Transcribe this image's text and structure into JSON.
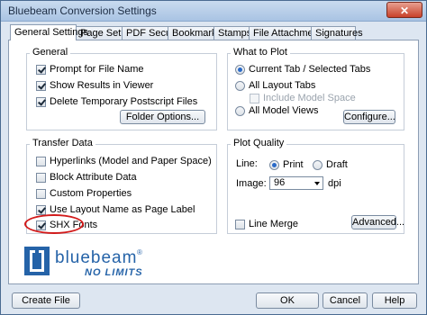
{
  "window": {
    "title": "Bluebeam Conversion Settings",
    "close_label": "✕"
  },
  "tabs": [
    {
      "label": "General Settings"
    },
    {
      "label": "Page Setup"
    },
    {
      "label": "PDF Security"
    },
    {
      "label": "Bookmarks"
    },
    {
      "label": "Stamps"
    },
    {
      "label": "File Attachments"
    },
    {
      "label": "Signatures"
    }
  ],
  "general": {
    "title": "General",
    "items": [
      {
        "label": "Prompt for File Name",
        "checked": true
      },
      {
        "label": "Show Results in Viewer",
        "checked": true
      },
      {
        "label": "Delete Temporary Postscript Files",
        "checked": true
      }
    ],
    "folder_options": "Folder Options..."
  },
  "what_to_plot": {
    "title": "What to Plot",
    "options": [
      {
        "label": "Current Tab / Selected Tabs",
        "selected": true
      },
      {
        "label": "All Layout Tabs",
        "selected": false
      },
      {
        "label": "All Model Views",
        "selected": false
      }
    ],
    "include_model_space": "Include Model Space",
    "configure": "Configure..."
  },
  "transfer_data": {
    "title": "Transfer Data",
    "items": [
      {
        "label": "Hyperlinks (Model and Paper Space)",
        "checked": false
      },
      {
        "label": "Block Attribute Data",
        "checked": false
      },
      {
        "label": "Custom Properties",
        "checked": false
      },
      {
        "label": "Use Layout Name as Page Label",
        "checked": true
      },
      {
        "label": "SHX Fonts",
        "checked": true
      }
    ]
  },
  "plot_quality": {
    "title": "Plot Quality",
    "line_label": "Line:",
    "print_label": "Print",
    "draft_label": "Draft",
    "image_label": "Image:",
    "image_value": "96",
    "dpi_label": "dpi",
    "line_merge": "Line Merge",
    "advanced": "Advanced..."
  },
  "logo": {
    "brand": "bluebeam",
    "tagline": "NO LIMITS",
    "mark": "®",
    "color": "#2563a8"
  },
  "footer": {
    "create_file": "Create File",
    "ok": "OK",
    "cancel": "Cancel",
    "help": "Help"
  }
}
